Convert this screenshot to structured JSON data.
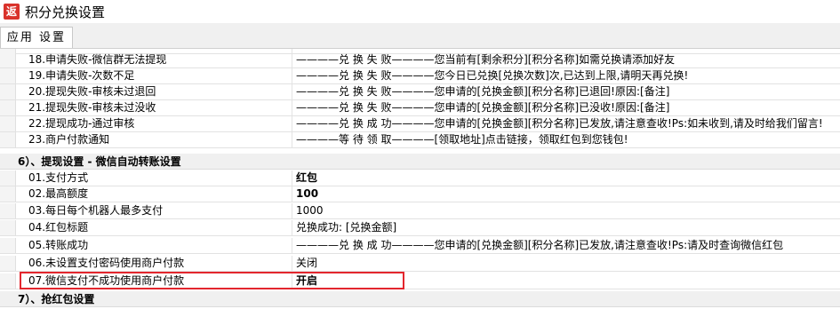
{
  "window": {
    "icon_glyph": "返",
    "title": "积分兑换设置"
  },
  "toolbar": {
    "apply_label": "应用 设置"
  },
  "rows_top": [
    {
      "name": "18.申请失败-微信群无法提现",
      "value": "————兑 换 失 败————您当前有[剩余积分][积分名称]如需兑换请添加好友"
    },
    {
      "name": "19.申请失败-次数不足",
      "value": "————兑 换 失 败————您今日已兑换[兑换次数]次,已达到上限,请明天再兑换!"
    },
    {
      "name": "20.提现失败-审核未过退回",
      "value": "————兑 换 失 败————您申请的[兑换金额][积分名称]已退回!原因:[备注]"
    },
    {
      "name": "21.提现失败-审核未过没收",
      "value": "————兑 换 失 败————您申请的[兑换金额][积分名称]已没收!原因:[备注]"
    },
    {
      "name": "22.提现成功-通过审核",
      "value": "————兑 换 成 功————您申请的[兑换金额][积分名称]已发放,请注意查收!Ps:如未收到,请及时给我们留言!"
    },
    {
      "name": "23.商户付款通知",
      "value": "————等 待 领 取————[领取地址]点击链接，领取红包到您钱包!"
    }
  ],
  "section6": {
    "title": "6）、提现设置 - 微信自动转账设置",
    "rows": [
      {
        "name": "01.支付方式",
        "value": "红包"
      },
      {
        "name": "02.最高额度",
        "value": "100"
      },
      {
        "name": "03.每日每个机器人最多支付",
        "value": "1000"
      },
      {
        "name": "04.红包标题",
        "value": "兑换成功: [兑换金额]"
      },
      {
        "name": "05.转账成功",
        "value": "————兑 换 成 功————您申请的[兑换金额][积分名称]已发放,请注意查收!Ps:请及时查询微信红包"
      },
      {
        "name": "06.未设置支付密码使用商户付款",
        "value": "关闭"
      },
      {
        "name": "07.微信支付不成功使用商户付款",
        "value": "开启"
      }
    ]
  },
  "section7": {
    "title": "7）、抢红包设置"
  },
  "colors": {
    "highlight": "#e3262d",
    "app_icon": "#d9322b"
  }
}
